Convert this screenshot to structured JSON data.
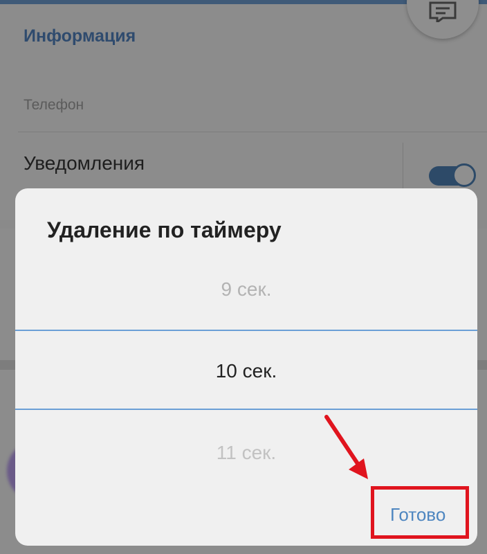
{
  "profile": {
    "section_title": "Информация",
    "phone_label": "Телефон",
    "notifications_label": "Уведомления",
    "notifications_enabled": true
  },
  "dialog": {
    "title": "Удаление по таймеру",
    "options": {
      "previous": "9 сек.",
      "selected": "10 сек.",
      "next": "11 сек."
    },
    "done_label": "Готово"
  },
  "colors": {
    "accent": "#4e86c0",
    "selection_line": "#6b9fd6",
    "annotation_red": "#e0141e",
    "toggle_on": "#2d4a68"
  },
  "icons": {
    "chat": "chat-icon",
    "arrow": "red-arrow-icon"
  }
}
